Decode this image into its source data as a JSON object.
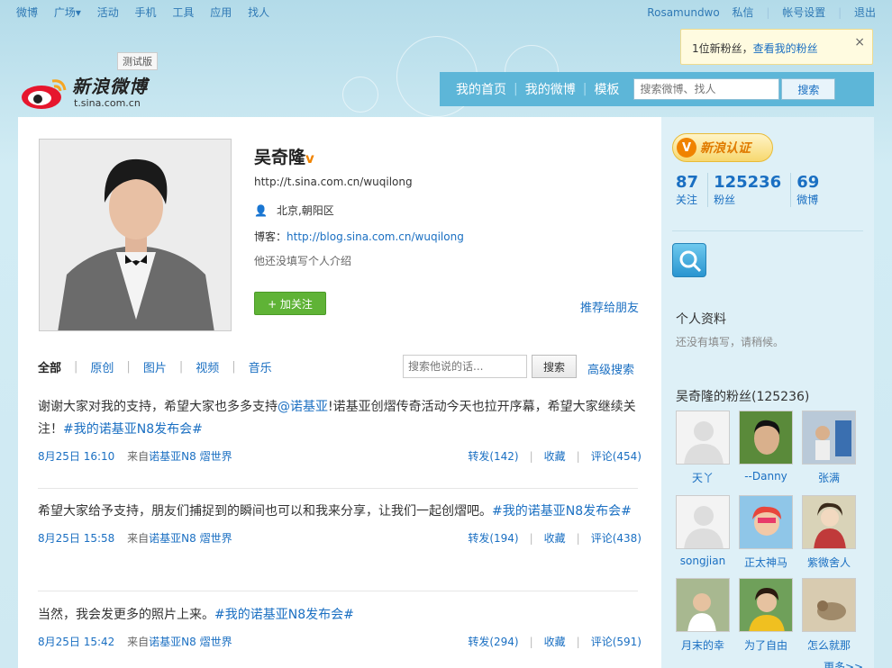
{
  "topnav": {
    "left": [
      "微博",
      "广场▾",
      "活动",
      "手机",
      "工具",
      "应用",
      "找人"
    ],
    "right": [
      "Rosamundwo",
      "私信",
      "帐号设置",
      "退出"
    ]
  },
  "notice": {
    "text": "1位新粉丝，",
    "link": "查看我的粉丝",
    "close": "×"
  },
  "logo": {
    "text": "新浪微博",
    "url": "t.sina.com.cn",
    "beta": "测试版"
  },
  "mainnav": {
    "items": [
      "我的首页",
      "我的微博",
      "模板"
    ],
    "search_placeholder": "搜索微博、找人",
    "search_button": "搜索"
  },
  "profile": {
    "name": "吴奇隆",
    "v": "v",
    "url": "http://t.sina.com.cn/wuqilong",
    "location": "北京,朝阳区",
    "blog_label": "博客：",
    "blog_url": "http://blog.sina.com.cn/wuqilong",
    "intro": "他还没填写个人介绍",
    "follow": "+ 加关注",
    "recommend": "推荐给朋友"
  },
  "tabs": [
    "全部",
    "原创",
    "图片",
    "视频",
    "音乐"
  ],
  "feed_search": {
    "placeholder": "搜索他说的话...",
    "button": "搜索",
    "advanced": "高级搜索"
  },
  "posts": [
    {
      "text_a": "谢谢大家对我的支持，希望大家也多多支持",
      "mention": "@诺基亚",
      "text_b": "!诺基亚创熠传奇活动今天也拉开序幕，希望大家继续关注！",
      "tag": "#我的诺基亚N8发布会#",
      "date": "8月25日 16:10",
      "from_label": "来自",
      "from": "诺基亚N8 熠世界",
      "repost": "转发(142)",
      "fav": "收藏",
      "comment": "评论(454)"
    },
    {
      "text_a": "希望大家给予支持，朋友们捕捉到的瞬间也可以和我来分享，让我们一起创熠吧。",
      "mention": "",
      "text_b": "",
      "tag": "#我的诺基亚N8发布会#",
      "date": "8月25日 15:58",
      "from_label": "来自",
      "from": "诺基亚N8 熠世界",
      "repost": "转发(194)",
      "fav": "收藏",
      "comment": "评论(438)"
    },
    {
      "text_a": "当然，我会发更多的照片上来。",
      "mention": "",
      "text_b": "",
      "tag": "#我的诺基亚N8发布会#",
      "date": "8月25日 15:42",
      "from_label": "来自",
      "from": "诺基亚N8 熠世界",
      "repost": "转发(294)",
      "fav": "收藏",
      "comment": "评论(591)"
    }
  ],
  "sidebar": {
    "verified": "新浪认证",
    "verified_v": "V",
    "stats": [
      {
        "num": "87",
        "label": "关注"
      },
      {
        "num": "125236",
        "label": "粉丝"
      },
      {
        "num": "69",
        "label": "微博"
      }
    ],
    "info_title": "个人资料",
    "info_note": "还没有填写，请稍候。",
    "fans_title": "吴奇隆的粉丝(125236)",
    "fans": [
      "天丫",
      "--Danny",
      "张满",
      "songjian",
      "正太神马",
      "紫微舍人",
      "月末的幸",
      "为了自由",
      "怎么就那"
    ],
    "more": "更多>>"
  },
  "colors": {
    "link": "#1a6fc2",
    "nav": "#5db6d8",
    "follow": "#5fb336",
    "verified": "#f08300"
  }
}
